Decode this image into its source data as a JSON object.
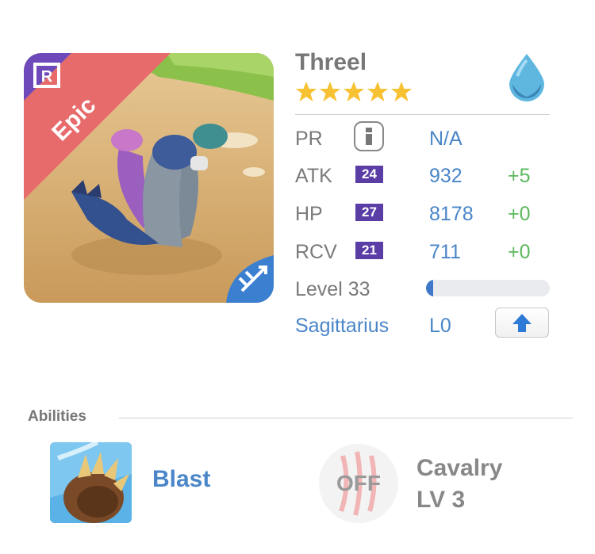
{
  "monster": {
    "name": "Threel",
    "rarity": "Epic",
    "rank_badge": "R",
    "stars": 5,
    "element_icon": "water-drop-icon",
    "class_icon": "archer-arrow-icon"
  },
  "stats": [
    {
      "label": "PR",
      "value": "N/A"
    },
    {
      "label": "ATK",
      "badge": "24",
      "value": "932",
      "bonus": "+5"
    },
    {
      "label": "HP",
      "badge": "27",
      "value": "8178",
      "bonus": "+0"
    },
    {
      "label": "RCV",
      "badge": "21",
      "value": "711",
      "bonus": "+0"
    }
  ],
  "level": {
    "label": "Level 33",
    "progress": 0.06
  },
  "sign": {
    "name": "Sagittarius",
    "level": "L0"
  },
  "abilities": {
    "title": "Abilities",
    "ability_name": "Blast",
    "off_label": "OFF",
    "skill_name": "Cavalry",
    "skill_level": "LV 3"
  },
  "colors": {
    "accent_blue": "#4a86c8",
    "bonus_green": "#5cb85c",
    "badge_purple": "#5a3ea6",
    "epic_ribbon": "#e86b6b"
  }
}
